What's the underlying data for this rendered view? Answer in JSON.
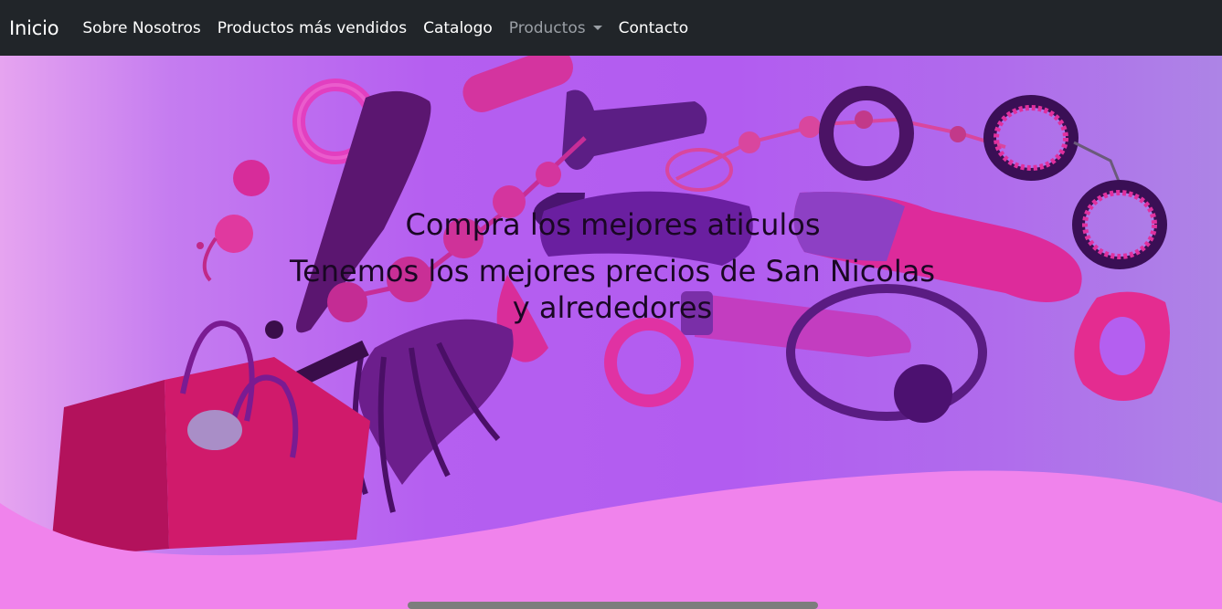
{
  "nav": {
    "brand": "Inicio",
    "items": [
      {
        "label": "Sobre Nosotros"
      },
      {
        "label": "Productos más vendidos"
      },
      {
        "label": "Catalogo"
      },
      {
        "label": "Productos"
      },
      {
        "label": "Contacto"
      }
    ]
  },
  "hero": {
    "headline": "Compra los mejores aticulos",
    "subline": "Tenemos los mejores precios de San Nicolas y alrededores"
  },
  "colors": {
    "navbar_bg": "#212529",
    "nav_text": "#ffffff",
    "nav_muted": "#9a9fa5",
    "hero_purple": "#b25cf0",
    "wave_pink": "#f083ec"
  },
  "icons": {
    "dropdown": "caret-down-icon"
  }
}
